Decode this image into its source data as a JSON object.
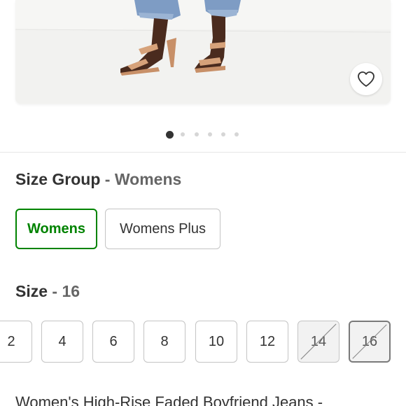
{
  "colors": {
    "accent_green": "#008300",
    "text_dark": "#333333",
    "text_muted": "#666666",
    "border": "#c4c4c4"
  },
  "product_image": {
    "favorite_icon": "heart-outline-icon",
    "carousel": {
      "dot_count": 6,
      "active_index": 0
    }
  },
  "size_group": {
    "label": "Size Group",
    "separator": "-",
    "selected_value": "Womens",
    "options": [
      {
        "label": "Womens",
        "selected": true
      },
      {
        "label": "Womens Plus",
        "selected": false
      }
    ]
  },
  "size": {
    "label": "Size",
    "separator": "-",
    "selected_value": "16",
    "options": [
      {
        "label": "2",
        "available": true,
        "selected": false
      },
      {
        "label": "4",
        "available": true,
        "selected": false
      },
      {
        "label": "6",
        "available": true,
        "selected": false
      },
      {
        "label": "8",
        "available": true,
        "selected": false
      },
      {
        "label": "10",
        "available": true,
        "selected": false
      },
      {
        "label": "12",
        "available": true,
        "selected": false
      },
      {
        "label": "14",
        "available": false,
        "selected": false
      },
      {
        "label": "16",
        "available": false,
        "selected": true
      }
    ]
  },
  "product": {
    "title": "Women's High-Rise Faded Boyfriend Jeans -"
  }
}
